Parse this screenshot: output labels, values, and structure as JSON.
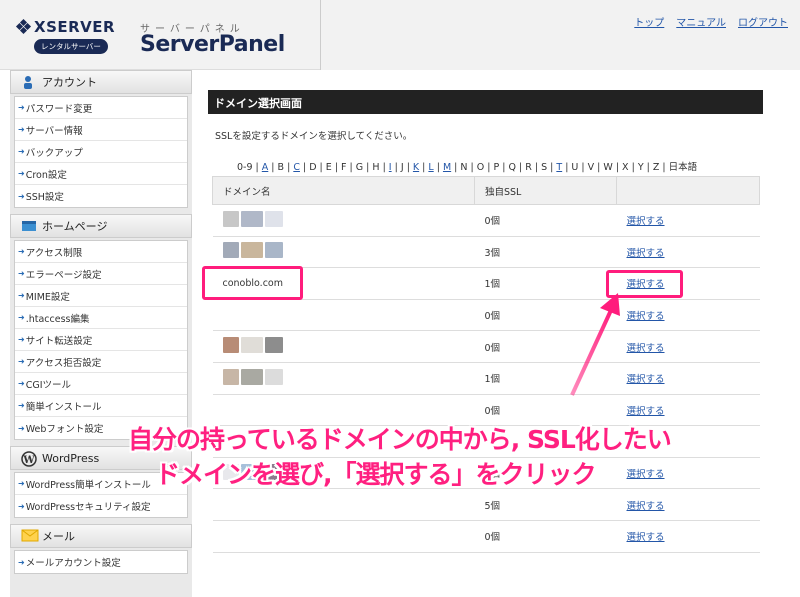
{
  "header": {
    "brand": "XSERVER",
    "brand_badge": "レンタルサーバー",
    "panel_sub": "サーバーパネル",
    "panel_title": "ServerPanel",
    "nav": [
      "トップ",
      "マニュアル",
      "ログアウト"
    ]
  },
  "sidebar": {
    "sections": [
      {
        "title": "アカウント",
        "icon": "person-icon",
        "items": [
          "パスワード変更",
          "サーバー情報",
          "バックアップ",
          "Cron設定",
          "SSH設定"
        ]
      },
      {
        "title": "ホームページ",
        "icon": "homepage-icon",
        "items": [
          "アクセス制限",
          "エラーページ設定",
          "MIME設定",
          ".htaccess編集",
          "サイト転送設定",
          "アクセス拒否設定",
          "CGIツール",
          "簡単インストール",
          "Webフォント設定"
        ]
      },
      {
        "title": "WordPress",
        "icon": "wordpress-icon",
        "items": [
          "WordPress簡単インストール",
          "WordPressセキュリティ設定"
        ]
      },
      {
        "title": "メール",
        "icon": "mail-icon",
        "items": [
          "メールアカウント設定"
        ]
      }
    ]
  },
  "main": {
    "title": "ドメイン選択画面",
    "description": "SSLを設定するドメインを選択してください。",
    "alpha_index": [
      "0-9",
      "A",
      "B",
      "C",
      "D",
      "E",
      "F",
      "G",
      "H",
      "I",
      "J",
      "K",
      "L",
      "M",
      "N",
      "O",
      "P",
      "Q",
      "R",
      "S",
      "T",
      "U",
      "V",
      "W",
      "X",
      "Y",
      "Z",
      "日本語"
    ],
    "alpha_links": [
      "A",
      "C",
      "I",
      "K",
      "L",
      "M",
      "T"
    ],
    "table": {
      "headers": [
        "ドメイン名",
        "独自SSL",
        ""
      ],
      "rows": [
        {
          "domain": "",
          "ssl": "0個",
          "action": "選択する",
          "blurs": [
            "#c7c7c7",
            "#b0b8c8",
            "#dfe2ea"
          ]
        },
        {
          "domain": "",
          "ssl": "3個",
          "action": "選択する",
          "blurs": [
            "#a2aab8",
            "#c9b69c",
            "#a9b6c8"
          ]
        },
        {
          "domain": "conoblo.com",
          "ssl": "1個",
          "action": "選択する",
          "blurs": []
        },
        {
          "domain": "",
          "ssl": "0個",
          "action": "選択する",
          "blurs": []
        },
        {
          "domain": "",
          "ssl": "0個",
          "action": "選択する",
          "blurs": [
            "#b88c76",
            "#e0ddd8",
            "#8d8d8d"
          ]
        },
        {
          "domain": "",
          "ssl": "1個",
          "action": "選択する",
          "blurs": [
            "#c7b6a6",
            "#a9a9a2",
            "#dcdcdc"
          ]
        },
        {
          "domain": "",
          "ssl": "0個",
          "action": "選択する",
          "blurs": []
        },
        {
          "domain": "",
          "ssl": "",
          "action": "",
          "blurs": []
        },
        {
          "domain": "",
          "ssl": "2個",
          "action": "選択する",
          "blurs": [
            "#e8e8ec",
            "#a6c0da",
            "#8d7a8d"
          ]
        },
        {
          "domain": "",
          "ssl": "5個",
          "action": "選択する",
          "blurs": []
        },
        {
          "domain": "",
          "ssl": "0個",
          "action": "選択する",
          "blurs": []
        }
      ]
    }
  },
  "annotation": {
    "line1": "自分の持っているドメインの中から, SSL化したい",
    "line2": "ドメインを選び,「選択する」をクリック",
    "color": "#ff1c7c"
  }
}
